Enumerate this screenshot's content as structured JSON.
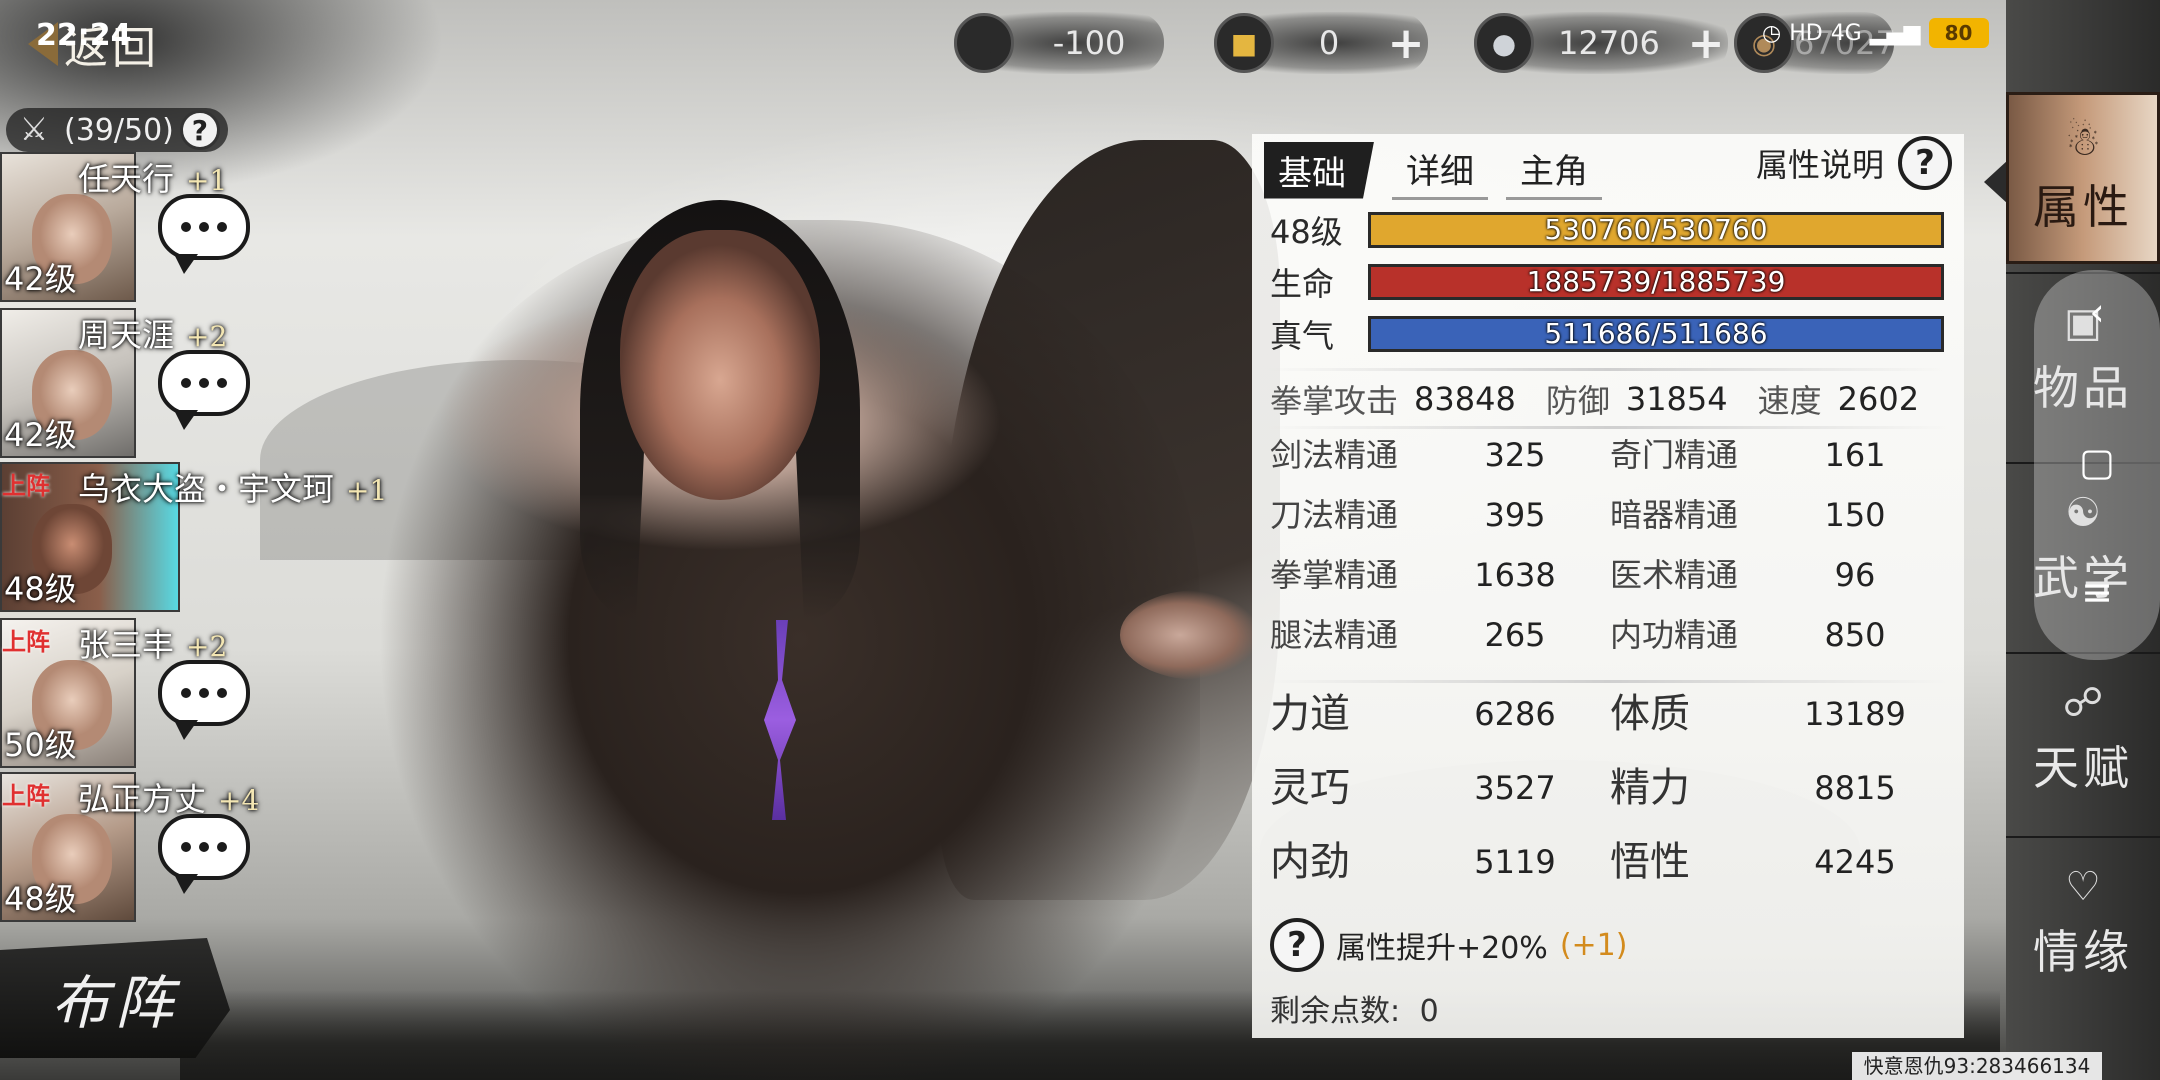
{
  "status": {
    "time": "22:24",
    "battery": "80",
    "network": "4G",
    "hd": "HD"
  },
  "topbar": {
    "back_label": "返回",
    "currencies": [
      {
        "icon": "cart-icon",
        "value": "-100"
      },
      {
        "icon": "gold-ingot-icon",
        "value": "0"
      },
      {
        "icon": "silver-ingot-icon",
        "value": "12706"
      },
      {
        "icon": "coin-icon",
        "value": "67027"
      }
    ]
  },
  "roster": {
    "count": "(39/50)",
    "members": [
      {
        "name": "任天行",
        "plus": "+1",
        "level": "42级",
        "deployed": false
      },
      {
        "name": "周天涯",
        "plus": "+2",
        "level": "42级",
        "deployed": false
      },
      {
        "name": "乌衣大盗・宇文珂",
        "plus": "+1",
        "level": "48级",
        "deployed": true,
        "active": true
      },
      {
        "name": "张三丰",
        "plus": "+2",
        "level": "50级",
        "deployed": true
      },
      {
        "name": "弘正方丈",
        "plus": "+4",
        "level": "48级",
        "deployed": true
      }
    ],
    "deployed_tag": "上阵",
    "formation_label": "布阵"
  },
  "stats": {
    "tabs": [
      "基础",
      "详细",
      "主角"
    ],
    "active_tab": 0,
    "attr_explain": "属性说明",
    "bars": [
      {
        "label": "48级",
        "text": "530760/530760",
        "fill_fraction": 1.0,
        "color": "#e0a72e"
      },
      {
        "label": "生命",
        "text": "1885739/1885739",
        "fill_fraction": 1.0,
        "color": "#b8312a"
      },
      {
        "label": "真气",
        "text": "511686/511686",
        "fill_fraction": 1.0,
        "color": "#3a63b8"
      }
    ],
    "combat": [
      {
        "label": "拳掌攻击",
        "value": "83848"
      },
      {
        "label": "防御",
        "value": "31854"
      },
      {
        "label": "速度",
        "value": "2602"
      }
    ],
    "mastery": [
      {
        "label": "剑法精通",
        "value": "325"
      },
      {
        "label": "奇门精通",
        "value": "161"
      },
      {
        "label": "刀法精通",
        "value": "395"
      },
      {
        "label": "暗器精通",
        "value": "150"
      },
      {
        "label": "拳掌精通",
        "value": "1638"
      },
      {
        "label": "医术精通",
        "value": "96"
      },
      {
        "label": "腿法精通",
        "value": "265"
      },
      {
        "label": "内功精通",
        "value": "850"
      }
    ],
    "base": [
      {
        "label": "力道",
        "value": "6286"
      },
      {
        "label": "体质",
        "value": "13189"
      },
      {
        "label": "灵巧",
        "value": "3527"
      },
      {
        "label": "精力",
        "value": "8815"
      },
      {
        "label": "内劲",
        "value": "5119"
      },
      {
        "label": "悟性",
        "value": "4245"
      }
    ],
    "bonus_text": "属性提升+20%",
    "bonus_plus": "(+1)",
    "points_label": "剩余点数:",
    "points_value": "0"
  },
  "menu": [
    {
      "label": "属性",
      "icon": "attribute-icon",
      "active": true
    },
    {
      "label": "物品",
      "icon": "item-box-icon"
    },
    {
      "label": "武学",
      "icon": "martial-arts-icon"
    },
    {
      "label": "天赋",
      "icon": "talent-icon"
    },
    {
      "label": "情缘",
      "icon": "heart-icon"
    }
  ],
  "footer": {
    "id_text": "快意恩仇93:283466134"
  }
}
